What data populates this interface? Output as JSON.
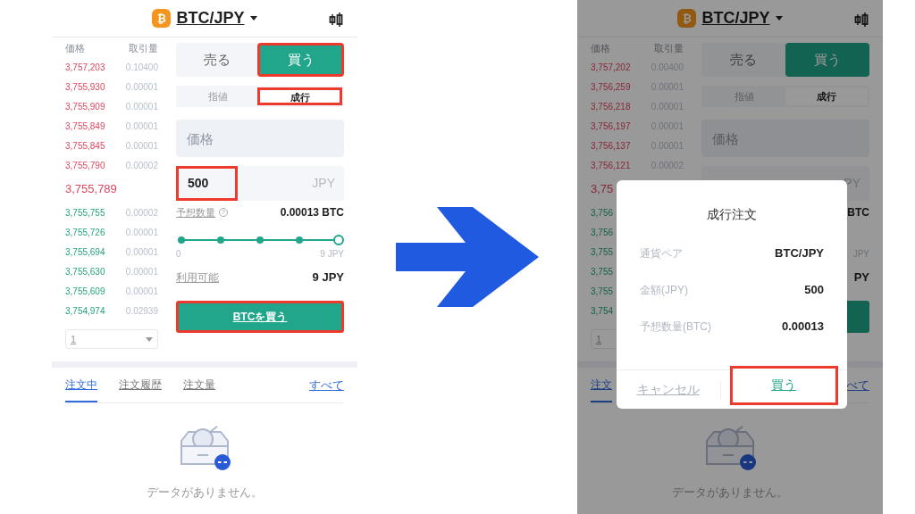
{
  "screens": [
    {
      "header": {
        "pair": "BTC/JPY",
        "coin": "₿"
      },
      "orderbook": {
        "price_label": "価格",
        "qty_label": "取引量",
        "asks": [
          {
            "price": "3,757,203",
            "qty": "0.10400"
          },
          {
            "price": "3,755,930",
            "qty": "0.00001"
          },
          {
            "price": "3,755,909",
            "qty": "0.00001"
          },
          {
            "price": "3,755,849",
            "qty": "0.00001"
          },
          {
            "price": "3,755,845",
            "qty": "0.00001"
          },
          {
            "price": "3,755,790",
            "qty": "0.00002"
          }
        ],
        "mid": "3,755,789",
        "bids": [
          {
            "price": "3,755,755",
            "qty": "0.00002"
          },
          {
            "price": "3,755,726",
            "qty": "0.00001"
          },
          {
            "price": "3,755,694",
            "qty": "0.00001"
          },
          {
            "price": "3,755,630",
            "qty": "0.00001"
          },
          {
            "price": "3,755,609",
            "qty": "0.00001"
          },
          {
            "price": "3,754,974",
            "qty": "0.02939"
          }
        ],
        "depth": {
          "value": "1",
          "caret": true
        }
      },
      "form": {
        "sides": [
          {
            "label": "売る",
            "selected": false,
            "highlighted": false
          },
          {
            "label": "買う",
            "selected": true,
            "highlighted": true
          }
        ],
        "types": [
          {
            "label": "指値",
            "selected": false,
            "highlighted": false
          },
          {
            "label": "成行",
            "selected": true,
            "highlighted": true
          }
        ],
        "price_placeholder": "価格",
        "amount": {
          "value": "500",
          "unit": "JPY",
          "highlighted": true
        },
        "estimate": {
          "label": "予想数量",
          "help": "?",
          "value": "0.00013 BTC"
        },
        "slider": {
          "level": 1,
          "min": "0",
          "max": "9 JPY"
        },
        "available": {
          "label": "利用可能",
          "value": "9 JPY"
        },
        "submit": {
          "label": "BTCを買う",
          "highlighted": true
        }
      },
      "tabs": [
        {
          "label": "注文中",
          "selected": true
        },
        {
          "label": "注文履歴",
          "selected": false
        },
        {
          "label": "注文量",
          "selected": false
        }
      ],
      "all_link": "すべて",
      "empty": "データがありません。"
    },
    {
      "header": {
        "pair": "BTC/JPY",
        "coin": "₿"
      },
      "orderbook": {
        "price_label": "価格",
        "qty_label": "取引量",
        "asks": [
          {
            "price": "3,757,202",
            "qty": "0.00400"
          },
          {
            "price": "3,756,259",
            "qty": "0.00001"
          },
          {
            "price": "3,756,218",
            "qty": "0.00001"
          },
          {
            "price": "3,756,197",
            "qty": "0.00001"
          },
          {
            "price": "3,756,137",
            "qty": "0.00001"
          },
          {
            "price": "3,756,121",
            "qty": "0.00002"
          }
        ],
        "mid": "3,75",
        "bids": [
          {
            "price": "3,756"
          },
          {
            "price": "3,756"
          },
          {
            "price": "3,755"
          },
          {
            "price": "3,755"
          },
          {
            "price": "3,755"
          },
          {
            "price": "3,754"
          }
        ],
        "depth": {
          "value": "1"
        }
      },
      "form": {
        "sides": [
          {
            "label": "売る",
            "selected": false,
            "highlighted": false
          },
          {
            "label": "買う",
            "selected": true,
            "highlighted": false
          }
        ],
        "types": [
          {
            "label": "指値",
            "selected": false,
            "highlighted": false
          },
          {
            "label": "成行",
            "selected": true,
            "highlighted": false
          }
        ],
        "price_placeholder": "価格",
        "amount": {
          "unit": "PY"
        },
        "estimate": {
          "value": "BTC"
        },
        "slider": {
          "max": "JPY"
        },
        "available": {
          "value": "PY"
        },
        "submit": {
          "highlighted": false
        }
      },
      "tabs": [
        {
          "label": "注文",
          "selected": true
        }
      ],
      "all_link": "べて",
      "empty": "データがありません。",
      "dialog": {
        "title": "成行注文",
        "rows": [
          {
            "label": "通貨ペア",
            "value": "BTC/JPY"
          },
          {
            "label": "金額(JPY)",
            "value": "500"
          },
          {
            "label": "予想数量(BTC)",
            "value": "0.00013"
          }
        ],
        "cancel": "キャンセル",
        "confirm": {
          "label": "買う",
          "highlighted": true
        }
      }
    }
  ]
}
